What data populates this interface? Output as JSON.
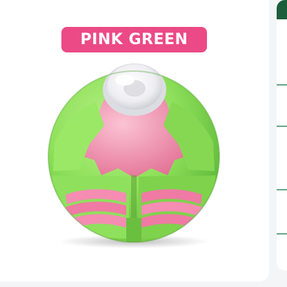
{
  "product": {
    "variant_label": "PINK GREEN",
    "image_subject": "pink-green-spinner-ball-toy",
    "colors": {
      "badge": "#ec4a86",
      "shell_green": "#8ee05a",
      "accent_pink": "#f58cb2",
      "cap_white": "#f4f4f6",
      "side_panel_dark": "#1b5e3c",
      "side_panel_line": "#2f8a5e"
    }
  }
}
